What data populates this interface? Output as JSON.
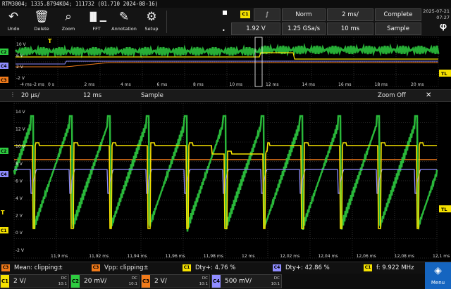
{
  "window": {
    "title": "RTM3004; 1335.8794K04; 111732 (01.710 2024-08-16)"
  },
  "toolbar": {
    "buttons": [
      {
        "label": "Undo",
        "icon": "undo-icon"
      },
      {
        "label": "Delete",
        "icon": "trash-icon"
      },
      {
        "label": "Zoom",
        "icon": "zoom-icon"
      },
      {
        "label": "FFT",
        "icon": "fft-icon"
      },
      {
        "label": "Annotation",
        "icon": "pencil-icon"
      },
      {
        "label": "Setup",
        "icon": "gear-icon"
      }
    ]
  },
  "acquisition": {
    "trigger_source": "C1",
    "trigger_slope_glyph": "∫",
    "trigger_mode": "Norm",
    "timebase": "2 ms/",
    "acq_state": "Complete",
    "trigger_level": "1.92 V",
    "sample_rate": "1.25 GSa/s",
    "record_length": "10 ms",
    "acq_mode": "Sample"
  },
  "clock": {
    "date": "2025-07-21",
    "time": "07:27"
  },
  "overview": {
    "y_labels": [
      "10 V",
      "6 V",
      "2 V",
      "-2 V"
    ],
    "x_labels": [
      "0 s",
      "2 ms",
      "4 ms",
      "6 ms",
      "8 ms",
      "10 ms",
      "12 ms",
      "14 ms",
      "16 ms",
      "18 ms",
      "20 ms"
    ],
    "neg_x_labels": [
      "-4 ms",
      "-2 ms"
    ],
    "left_markers": [
      "C2",
      "C4",
      "C3"
    ],
    "trigger_marker": "T",
    "tl_marker": "TL"
  },
  "zoom_bar": {
    "zoom_timebase": "20 µs/",
    "zoom_position": "12 ms",
    "zoom_acq_mode": "Sample",
    "zoom_off_label": "Zoom Off"
  },
  "main": {
    "y_labels": [
      "14 V",
      "12 V",
      "10 V",
      "8 V",
      "6 V",
      "4 V",
      "2 V",
      "0 V",
      "-2 V",
      "-4 V"
    ],
    "x_labels": [
      "11,9 ms",
      "11,92 ms",
      "11,94 ms",
      "11,96 ms",
      "11,98 ms",
      "12 ms",
      "12,02 ms",
      "12,04 ms",
      "12,06 ms",
      "12,08 ms",
      "12,1 ms"
    ],
    "left_markers": [
      "C2",
      "C4",
      "T",
      "C1"
    ],
    "tl_marker": "TL"
  },
  "measurements": [
    {
      "badge": "C3",
      "text": "Mean: clipping±",
      "color": "#f07a1a"
    },
    {
      "badge": "C3",
      "text": "Vpp: clipping±",
      "color": "#f07a1a"
    },
    {
      "badge": "C1",
      "text": "Dty+: 4.76 %",
      "color": "#f5e100"
    },
    {
      "badge": "C4",
      "text": "Dty+: 42.86 %",
      "color": "#9a8cff"
    },
    {
      "badge": "C1",
      "text": "f: 9.922 MHz",
      "color": "#f5e100"
    }
  ],
  "channels": [
    {
      "tag": "C1",
      "scale": "2 V/",
      "coupling": "DC",
      "ratio": "10:1",
      "color": "#f5e100"
    },
    {
      "tag": "C2",
      "scale": "20 mV/",
      "coupling": "DC",
      "ratio": "10:1",
      "color": "#2ecc40"
    },
    {
      "tag": "C3",
      "scale": "2 V/",
      "coupling": "DC",
      "ratio": "10:1",
      "color": "#f07a1a"
    },
    {
      "tag": "C4",
      "scale": "500 mV/",
      "coupling": "DC",
      "ratio": "10:1",
      "color": "#8f8cff"
    }
  ],
  "menu": {
    "label": "Menu",
    "icon": "rs-logo-icon"
  },
  "colors": {
    "c1": "#f5e100",
    "c2": "#2ecc40",
    "c3": "#f07a1a",
    "c4": "#8f8cff",
    "accent": "#1565c0"
  }
}
